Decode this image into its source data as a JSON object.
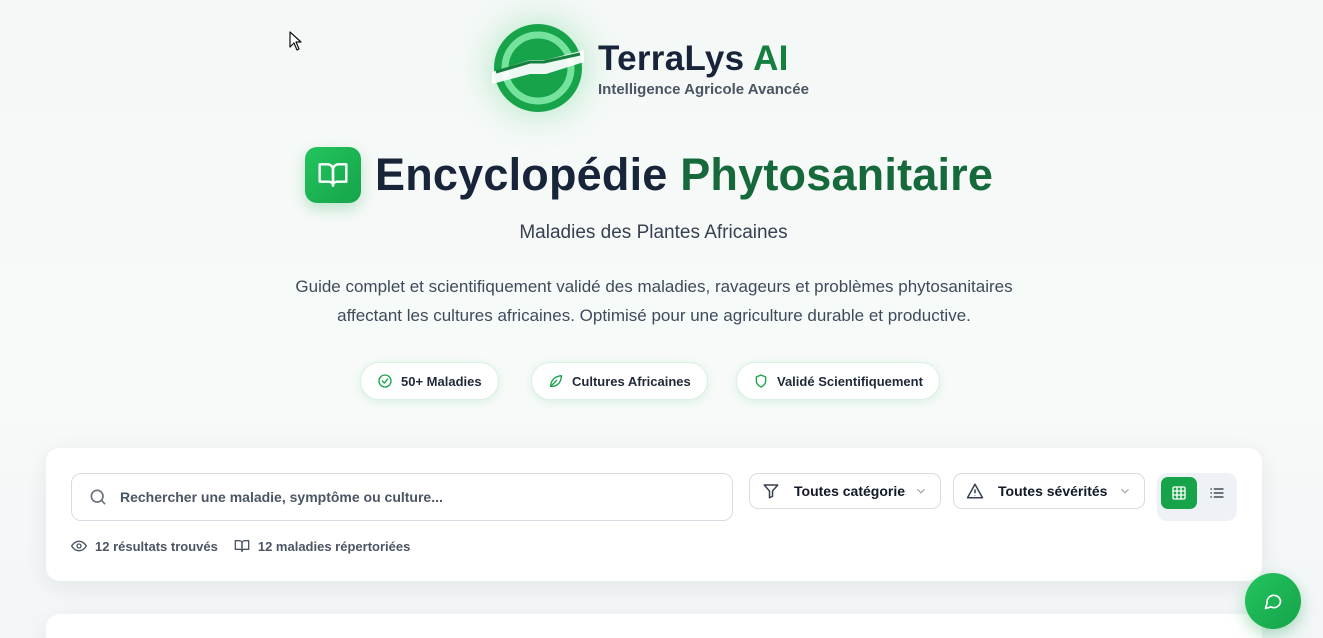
{
  "brand": {
    "name_part1": "TerraLys",
    "name_part2": "AI",
    "tagline": "Intelligence Agricole Avancée"
  },
  "hero": {
    "title_part1": "Encyclopédie",
    "title_part2": "Phytosanitaire",
    "subtitle": "Maladies des Plantes Africaines",
    "description_line1": "Guide complet et scientifiquement validé des maladies, ravageurs et problèmes phytosanitaires",
    "description_line2": "affectant les cultures africaines. Optimisé pour une agriculture durable et productive."
  },
  "badges": [
    {
      "label": "50+ Maladies",
      "icon": "check-circle-icon"
    },
    {
      "label": "Cultures Africaines",
      "icon": "leaf-icon"
    },
    {
      "label": "Validé Scientifiquement",
      "icon": "shield-icon"
    }
  ],
  "search": {
    "placeholder": "Rechercher une maladie, symptôme ou culture...",
    "value": ""
  },
  "filters": {
    "category": "Toutes catégories",
    "severity": "Toutes sévérités"
  },
  "view_mode": "grid",
  "stats": {
    "results": "12 résultats trouvés",
    "catalogued": "12 maladies répertoriées"
  },
  "colors": {
    "brand_green": "#16a34a",
    "dark_navy": "#17243a",
    "title_green": "#15693a"
  }
}
